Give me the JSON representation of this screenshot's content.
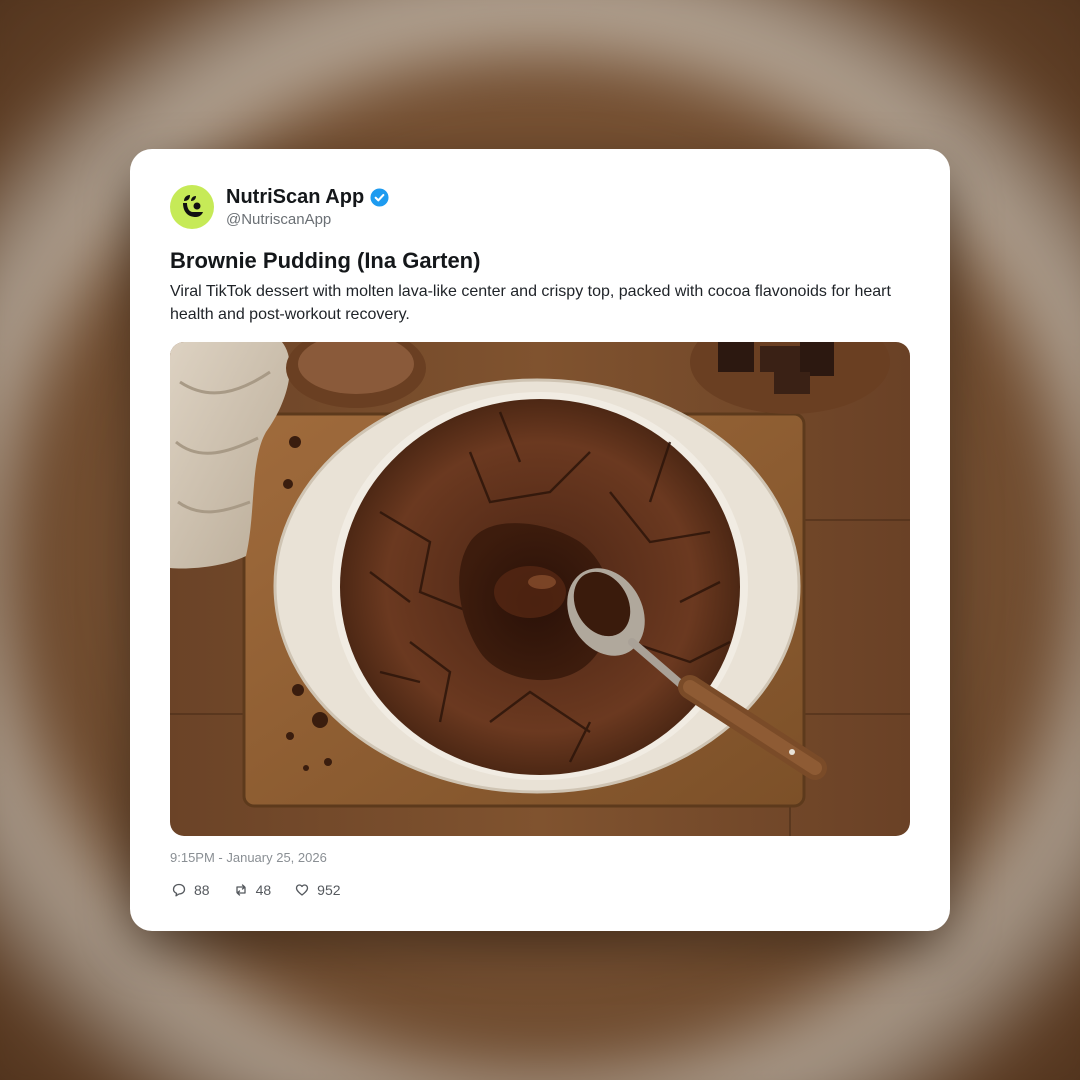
{
  "account": {
    "name": "NutriScan App",
    "handle": "@NutriscanApp",
    "verified": true,
    "avatar_color": "#c6ea57",
    "verified_color": "#1d9bf0"
  },
  "post": {
    "title": "Brownie Pudding (Ina Garten)",
    "body": "Viral TikTok dessert with molten lava-like center and crispy top, packed with cocoa flavonoids for heart health and post-workout recovery.",
    "image": "brownie-pudding-photo",
    "timestamp": "9:15PM - January 25, 2026"
  },
  "stats": {
    "replies": "88",
    "reposts": "48",
    "likes": "952"
  },
  "icons": {
    "reply": "speech-bubble-icon",
    "repost": "repost-arrows-icon",
    "like": "heart-icon",
    "verified": "verified-badge-icon",
    "avatar": "leaf-logo-icon"
  }
}
